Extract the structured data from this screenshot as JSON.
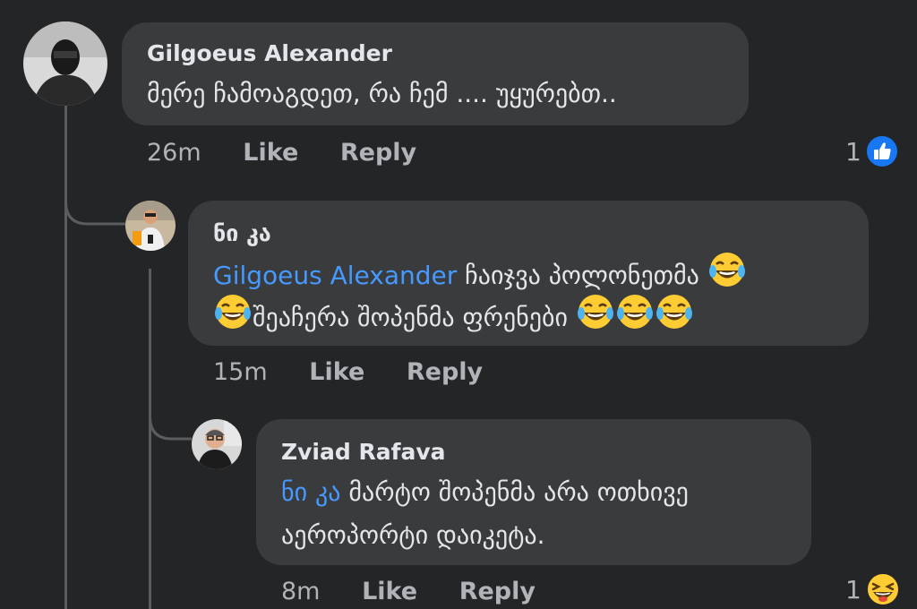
{
  "comments": [
    {
      "author": "Gilgoeus Alexander",
      "lines": [
        "მერე ჩამოაგდეთ, რა ჩემ .... უყურებთ.."
      ],
      "time": "26m",
      "like_label": "Like",
      "reply_label": "Reply",
      "reaction_count": "1",
      "reaction_icon": "like-icon"
    },
    {
      "author": "ნი კა",
      "mention": "Gilgoeus Alexander",
      "line1_text": " ჩაიჯვა პოლონეთმა ",
      "line2_text": "შეაჩერა შოპენმა ფრენები ",
      "time": "15m",
      "like_label": "Like",
      "reply_label": "Reply"
    },
    {
      "author": "Zviad Rafava",
      "mention": "ნი კა",
      "line1_text": " მარტო შოპენმა არა ოთხივე",
      "line2_text": "აეროპორტი დაიკეტა.",
      "time": "8m",
      "like_label": "Like",
      "reply_label": "Reply",
      "reaction_count": "1",
      "reaction_icon": "haha-icon"
    }
  ],
  "colors": {
    "background": "#242526",
    "bubble": "#3a3b3c",
    "text": "#e4e6eb",
    "meta": "#b0b3b8",
    "mention": "#4599ff",
    "like_blue": "#1877f2"
  }
}
